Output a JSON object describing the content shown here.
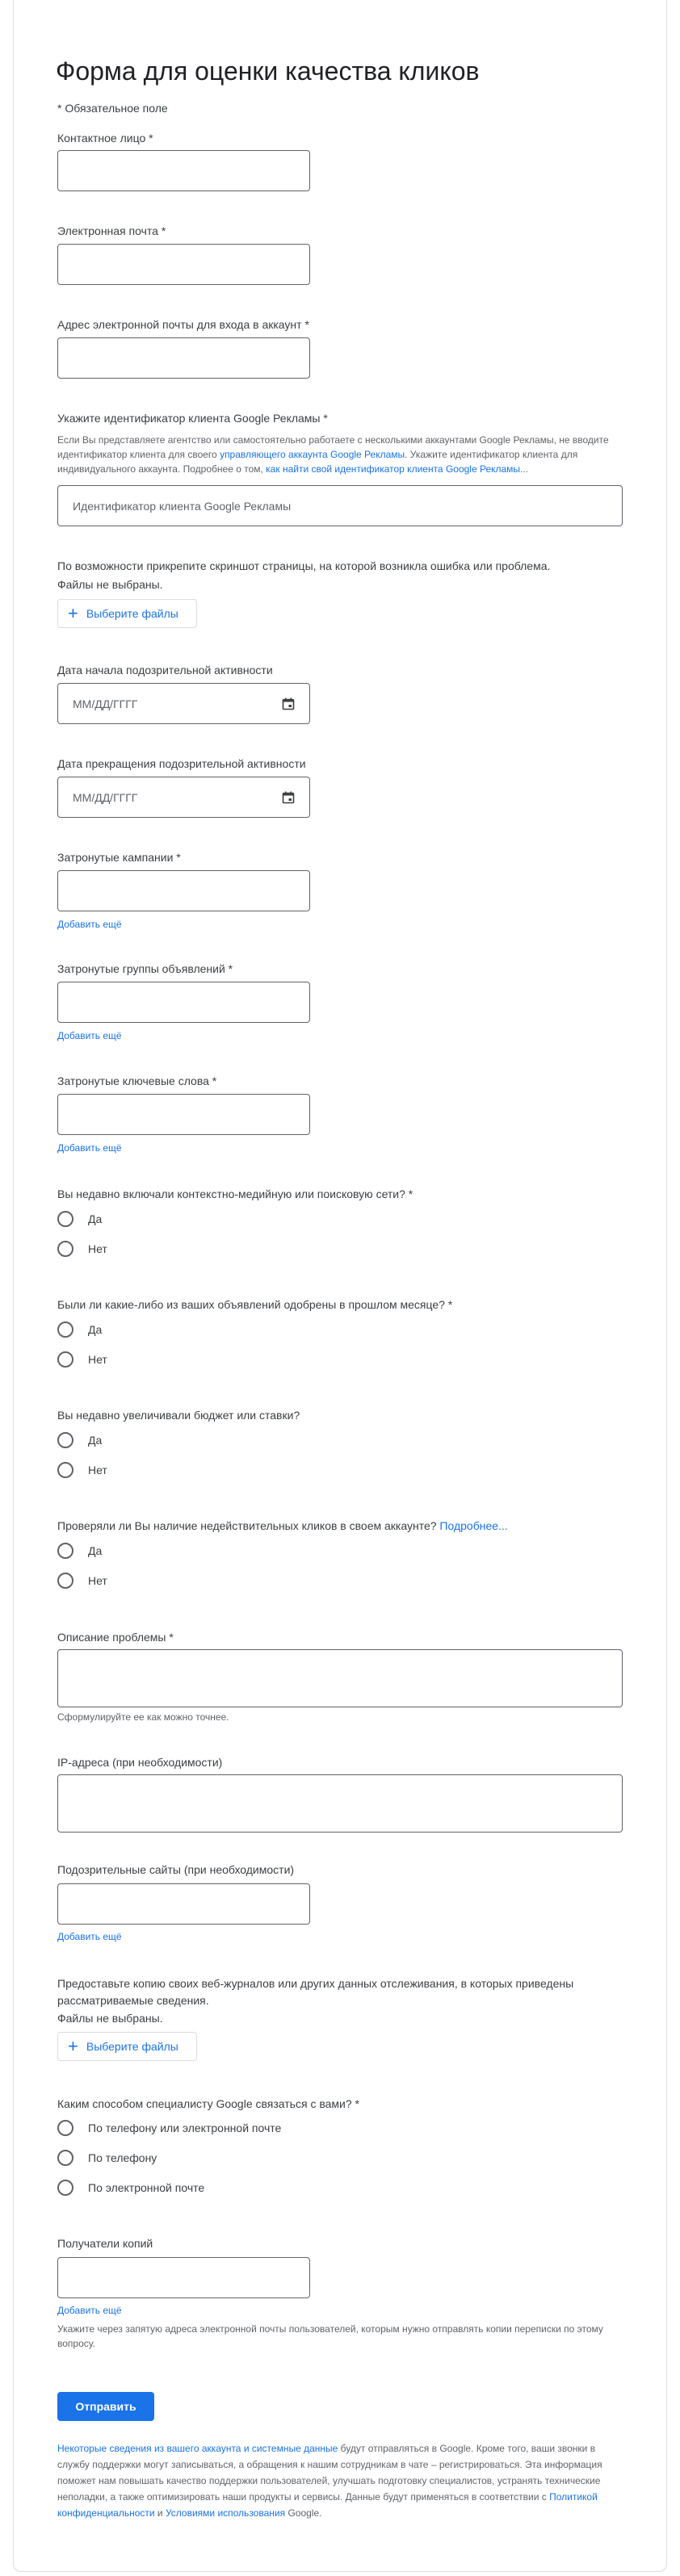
{
  "form": {
    "title": "Форма для оценки качества кликов",
    "required_note": "* Обязательное поле",
    "contact": {
      "label": "Контактное лицо *"
    },
    "email": {
      "label": "Электронная почта *"
    },
    "login_email": {
      "label": "Адрес электронной почты для входа в аккаунт *"
    },
    "customer_id": {
      "label": "Укажите идентификатор клиента Google Рекламы *",
      "help_1": "Если Вы представляете агентство или самостоятельно работаете с несколькими аккаунтами Google Рекламы, не вводите идентификатор клиента для своего ",
      "help_link_1": "управляющего аккаунта Google Рекламы",
      "help_2": ". Укажите идентификатор клиента для индивидуального аккаунта. Подробнее о том, ",
      "help_link_2": "как найти свой идентификатор клиента Google Рекламы",
      "help_3": "...",
      "placeholder": "Идентификатор клиента Google Рекламы"
    },
    "screenshot": {
      "label": "По возможности прикрепите скриншот страницы, на которой возникла ошибка или проблема.",
      "files_none": "Файлы не выбраны.",
      "button": "Выберите файлы"
    },
    "start_date": {
      "label": "Дата начала подозрительной активности",
      "placeholder": "ММ/ДД/ГГГГ"
    },
    "end_date": {
      "label": "Дата прекращения подозрительной активности",
      "placeholder": "ММ/ДД/ГГГГ"
    },
    "campaigns": {
      "label": "Затронутые кампании *",
      "add_more": "Добавить ещё"
    },
    "ad_groups": {
      "label": "Затронутые группы объявлений *",
      "add_more": "Добавить ещё"
    },
    "keywords": {
      "label": "Затронутые ключевые слова *",
      "add_more": "Добавить ещё"
    },
    "q_network": {
      "label": "Вы недавно включали контекстно-медийную или поисковую сети? *",
      "options": [
        "Да",
        "Нет"
      ]
    },
    "q_approved": {
      "label": "Были ли какие-либо из ваших объявлений одобрены в прошлом месяце? *",
      "options": [
        "Да",
        "Нет"
      ]
    },
    "q_budget": {
      "label": "Вы недавно увеличивали бюджет или ставки?",
      "options": [
        "Да",
        "Нет"
      ]
    },
    "q_invalid": {
      "label": "Проверяли ли Вы наличие недействительных кликов в своем аккаунте? ",
      "link": "Подробнее...",
      "options": [
        "Да",
        "Нет"
      ]
    },
    "description": {
      "label": "Описание проблемы *",
      "help": "Сформулируйте ее как можно точнее."
    },
    "ip": {
      "label": "IP-адреса (при необходимости)"
    },
    "sites": {
      "label": "Подозрительные сайты (при необходимости)",
      "add_more": "Добавить ещё"
    },
    "logs": {
      "label": "Предоставьте копию своих веб-журналов или других данных отслеживания, в которых приведены рассматриваемые сведения.",
      "files_none": "Файлы не выбраны.",
      "button": "Выберите файлы"
    },
    "contact_method": {
      "label": "Каким способом специалисту Google связаться с вами? *",
      "options": [
        "По телефону или электронной почте",
        "По телефону",
        "По электронной почте"
      ]
    },
    "cc": {
      "label": "Получатели копий",
      "add_more": "Добавить ещё",
      "help": "Укажите через запятую адреса электронной почты пользователей, которым нужно отправлять копии переписки по этому вопросу."
    },
    "submit": "Отправить",
    "footer": {
      "link_1": "Некоторые сведения из вашего аккаунта и системные данные",
      "text_1": " будут отправляться в Google. Кроме того, ваши звонки в службу поддержки могут записываться, а обращения к нашим сотрудникам в чате – регистрироваться. Эта информация поможет нам повышать качество поддержки пользователей, улучшать подготовку специалистов, устранять технические неполадки, а также оптимизировать наши продукты и сервисы. Данные будут применяться в соответствии с ",
      "link_2": "Политикой конфиденциальности",
      "text_2": " и ",
      "link_3": "Условиями использования",
      "text_3": " Google."
    }
  }
}
